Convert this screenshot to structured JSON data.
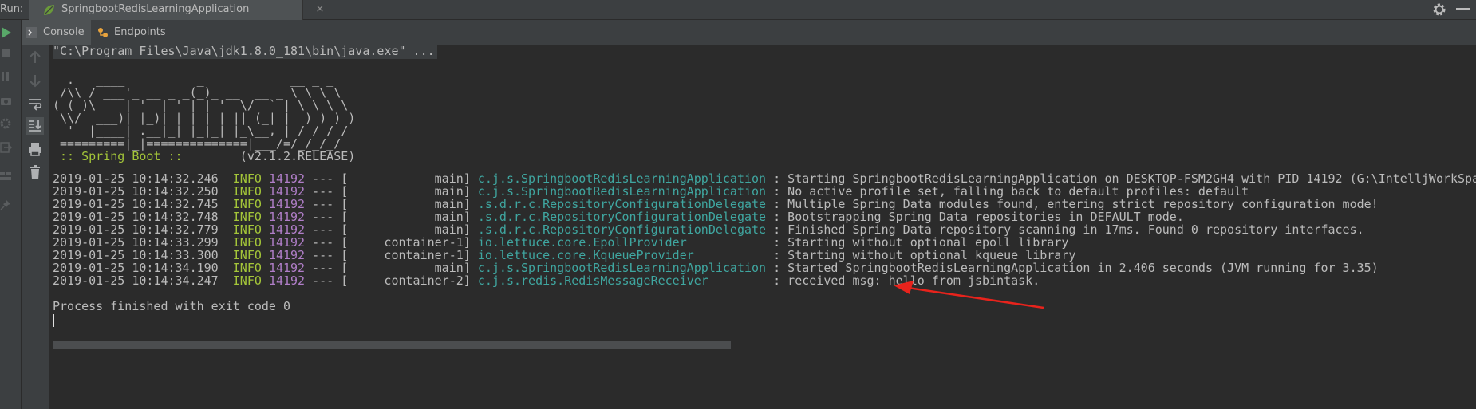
{
  "run_header": {
    "label": "Run:",
    "tab_title": "SpringbootRedisLearningApplication",
    "close_glyph": "×",
    "icons": [
      "spring-leaf-icon",
      "gear-icon",
      "minimize-icon"
    ]
  },
  "console_tabs": [
    {
      "label": "Console",
      "icon": "console-icon"
    },
    {
      "label": "Endpoints",
      "icon": "endpoints-icon"
    }
  ],
  "left_toolbar": {
    "icons": [
      "rerun-icon",
      "stop-icon",
      "pause-icon",
      "camera-icon",
      "settings-icon",
      "exit-icon",
      "layout-icon",
      "pin-icon"
    ]
  },
  "console_gutter": {
    "icons": [
      "scroll-up-icon",
      "scroll-down-icon",
      "soft-wrap-icon",
      "scroll-to-end-icon",
      "print-icon",
      "clear-all-icon"
    ]
  },
  "console": {
    "command": "\"C:\\Program Files\\Java\\jdk1.8.0_181\\bin\\java.exe\" ...",
    "banner": [
      "  .   ____          _            __ _ _",
      " /\\\\ / ___'_ __ _ _(_)_ __  __ _ \\ \\ \\ \\",
      "( ( )\\___ | '_ | '_| | '_ \\/ _` | \\ \\ \\ \\",
      " \\\\/  ___)| |_)| | | | | || (_| |  ) ) ) )",
      "  '  |____| .__|_| |_|_| |_\\__, | / / / /",
      " =========|_|==============|___/=/_/_/_/"
    ],
    "spring_boot_label": " :: Spring Boot :: ",
    "spring_boot_version": "       (v2.1.2.RELEASE)",
    "log_lines": [
      {
        "timestamp": "2019-01-25 10:14:32.246",
        "level": "INFO",
        "pid": "14192",
        "sep": "--- [",
        "thread": "           main]",
        "logger": "c.j.s.SpringbootRedisLearningApplication",
        "message": " : Starting SpringbootRedisLearningApplication on DESKTOP-FSM2GH4 with PID 14192 (G:\\IntelljWorkSpa"
      },
      {
        "timestamp": "2019-01-25 10:14:32.250",
        "level": "INFO",
        "pid": "14192",
        "sep": "--- [",
        "thread": "           main]",
        "logger": "c.j.s.SpringbootRedisLearningApplication",
        "message": " : No active profile set, falling back to default profiles: default"
      },
      {
        "timestamp": "2019-01-25 10:14:32.745",
        "level": "INFO",
        "pid": "14192",
        "sep": "--- [",
        "thread": "           main]",
        "logger": ".s.d.r.c.RepositoryConfigurationDelegate",
        "message": " : Multiple Spring Data modules found, entering strict repository configuration mode!"
      },
      {
        "timestamp": "2019-01-25 10:14:32.748",
        "level": "INFO",
        "pid": "14192",
        "sep": "--- [",
        "thread": "           main]",
        "logger": ".s.d.r.c.RepositoryConfigurationDelegate",
        "message": " : Bootstrapping Spring Data repositories in DEFAULT mode."
      },
      {
        "timestamp": "2019-01-25 10:14:32.779",
        "level": "INFO",
        "pid": "14192",
        "sep": "--- [",
        "thread": "           main]",
        "logger": ".s.d.r.c.RepositoryConfigurationDelegate",
        "message": " : Finished Spring Data repository scanning in 17ms. Found 0 repository interfaces."
      },
      {
        "timestamp": "2019-01-25 10:14:33.299",
        "level": "INFO",
        "pid": "14192",
        "sep": "--- [",
        "thread": "    container-1]",
        "logger": "io.lettuce.core.EpollProvider           ",
        "message": " : Starting without optional epoll library"
      },
      {
        "timestamp": "2019-01-25 10:14:33.300",
        "level": "INFO",
        "pid": "14192",
        "sep": "--- [",
        "thread": "    container-1]",
        "logger": "io.lettuce.core.KqueueProvider          ",
        "message": " : Starting without optional kqueue library"
      },
      {
        "timestamp": "2019-01-25 10:14:34.190",
        "level": "INFO",
        "pid": "14192",
        "sep": "--- [",
        "thread": "           main]",
        "logger": "c.j.s.SpringbootRedisLearningApplication",
        "message": " : Started SpringbootRedisLearningApplication in 2.406 seconds (JVM running for 3.35)"
      },
      {
        "timestamp": "2019-01-25 10:14:34.247",
        "level": "INFO",
        "pid": "14192",
        "sep": "--- [",
        "thread": "    container-2]",
        "logger": "c.j.s.redis.RedisMessageReceiver        ",
        "message": " : received msg: hello from jsbintask."
      }
    ],
    "exit_message": "Process finished with exit code 0"
  },
  "colors": {
    "background": "#2b2b2b",
    "panel": "#3c3f41",
    "info": "#a4c639",
    "pid": "#b07ec8",
    "logger": "#3fa6a0",
    "text": "#bbbbbb",
    "arrow": "#e8231c"
  }
}
